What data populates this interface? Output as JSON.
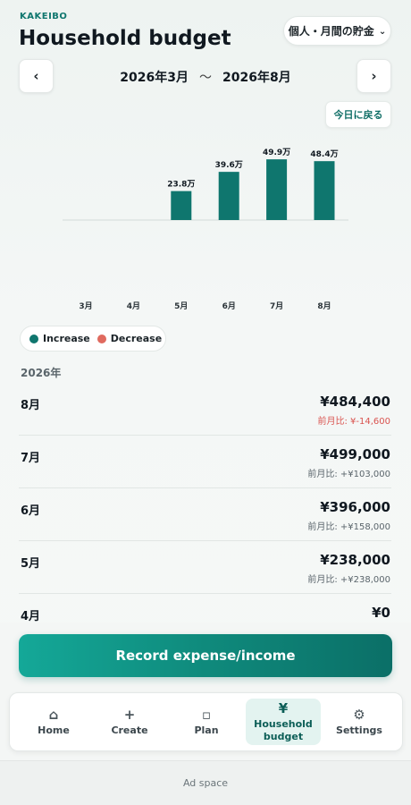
{
  "header": {
    "brand": "KAKEIBO",
    "title": "Household budget",
    "goal_select": "個人・月間の貯金"
  },
  "period": {
    "start": "2026年3月",
    "separator": "〜",
    "end": "2026年8月",
    "today_label": "今日に戻る"
  },
  "icons": {
    "prev": "chevron-left-icon",
    "next": "chevron-right-icon",
    "select": "chevron-down-icon"
  },
  "colors": {
    "increase": "#0f766e",
    "decrease": "#e06a5f",
    "accent": "#0f766e"
  },
  "chart_data": {
    "type": "bar",
    "categories": [
      "3月",
      "4月",
      "5月",
      "6月",
      "7月",
      "8月"
    ],
    "values": [
      0,
      0,
      23.8,
      39.6,
      49.9,
      48.4
    ],
    "data_labels": [
      "",
      "",
      "23.8万",
      "39.6万",
      "49.9万",
      "48.4万"
    ],
    "unit": "万",
    "ylim": [
      0,
      50
    ],
    "grid": false
  },
  "legend": {
    "increase": "Increase",
    "decrease": "Decrease"
  },
  "year_label": "2026年",
  "months": [
    {
      "month": "8月",
      "amount": "¥484,400",
      "diff": "前月比: ¥-14,600",
      "negative": true
    },
    {
      "month": "7月",
      "amount": "¥499,000",
      "diff": "前月比: +¥103,000",
      "negative": false
    },
    {
      "month": "6月",
      "amount": "¥396,000",
      "diff": "前月比: +¥158,000",
      "negative": false
    },
    {
      "month": "5月",
      "amount": "¥238,000",
      "diff": "前月比: +¥238,000",
      "negative": false
    },
    {
      "month": "4月",
      "amount": "¥0",
      "diff": "",
      "negative": false
    }
  ],
  "record_button": "Record expense/income",
  "tabs": [
    {
      "label": "Home",
      "icon": "home-icon",
      "glyph": "⌂"
    },
    {
      "label": "Create",
      "icon": "plus-icon",
      "glyph": "+"
    },
    {
      "label": "Plan",
      "icon": "square-icon",
      "glyph": "▫"
    },
    {
      "label": "Household budget",
      "icon": "yen-icon",
      "glyph": "¥"
    },
    {
      "label": "Settings",
      "icon": "gear-icon",
      "glyph": "⚙"
    }
  ],
  "ad_label": "Ad space"
}
